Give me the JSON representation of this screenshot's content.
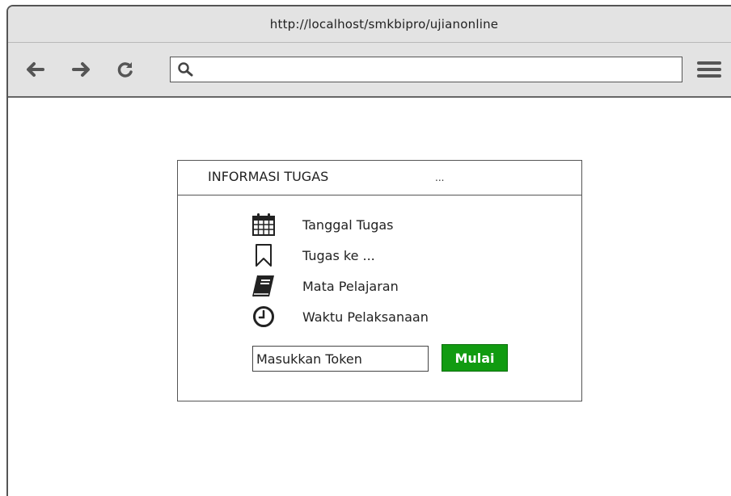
{
  "browser": {
    "title_url": "http://localhost/smkbipro/ujianonline",
    "address_value": "",
    "icons": {
      "back": "arrow-left-icon",
      "forward": "arrow-right-icon",
      "reload": "reload-icon",
      "search": "search-icon",
      "menu": "hamburger-menu-icon"
    }
  },
  "card": {
    "title": "INFORMASI TUGAS",
    "title_suffix": "...",
    "items": [
      {
        "icon": "calendar-icon",
        "label": "Tanggal Tugas"
      },
      {
        "icon": "bookmark-icon",
        "label": "Tugas ke ..."
      },
      {
        "icon": "book-icon",
        "label": "Mata Pelajaran"
      },
      {
        "icon": "clock-icon",
        "label": "Waktu Pelaksanaan"
      }
    ],
    "token_placeholder": "Masukkan Token",
    "start_button": "Mulai"
  },
  "colors": {
    "chrome_bg": "#e3e3e3",
    "start_button_bg": "#119b11",
    "start_button_text": "#ffffff"
  }
}
